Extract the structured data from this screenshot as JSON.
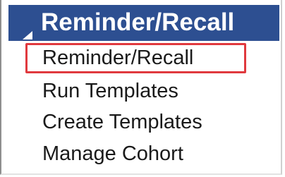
{
  "menu": {
    "header": {
      "title": "Reminder/Recall",
      "expand_icon": "expanded-triangle-icon",
      "color": "#2d4f91"
    },
    "items": [
      {
        "label": "Reminder/Recall",
        "highlighted": true
      },
      {
        "label": "Run Templates"
      },
      {
        "label": "Create Templates"
      },
      {
        "label": "Manage Cohort"
      }
    ],
    "highlight_color": "#e0393e"
  }
}
